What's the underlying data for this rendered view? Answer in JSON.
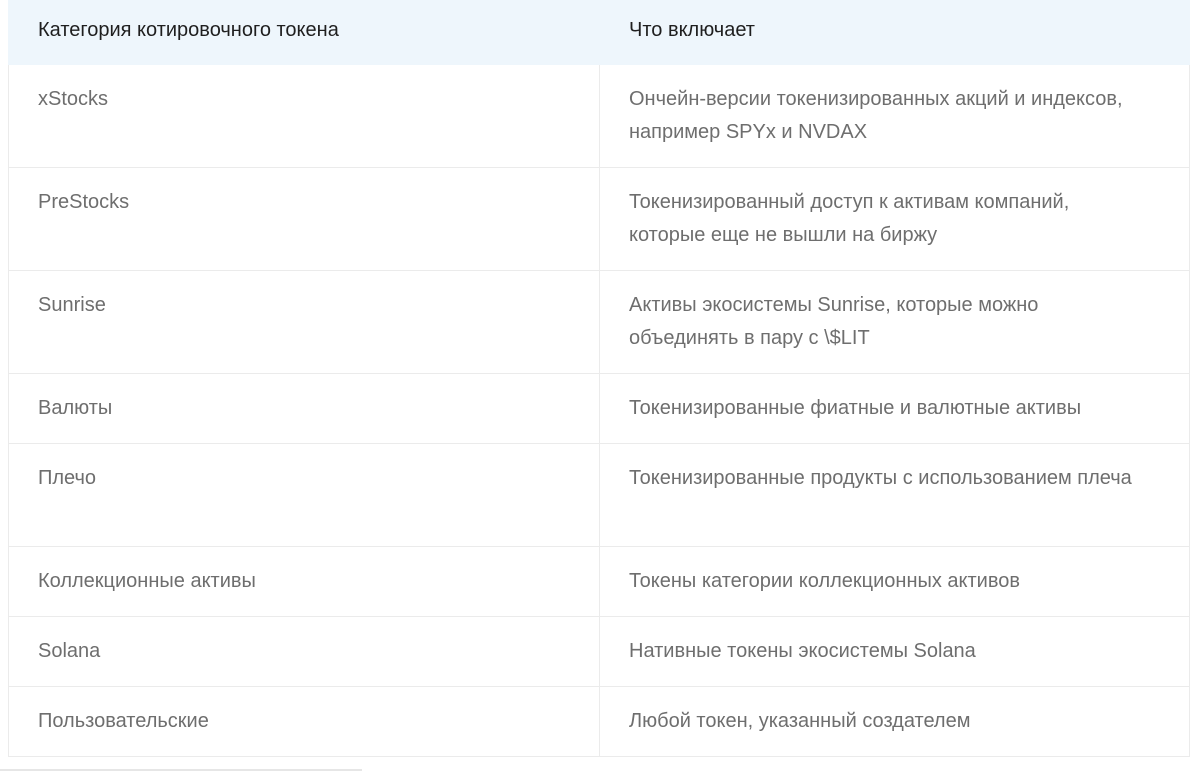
{
  "table": {
    "headers": [
      "Категория котировочного токена",
      "Что включает"
    ],
    "rows": [
      [
        "xStocks",
        "Ончейн-версии токенизированных акций и индексов, например SPYx и NVDAX"
      ],
      [
        "PreStocks",
        "Токенизированный доступ к активам компаний, которые еще не вышли на биржу"
      ],
      [
        "Sunrise",
        "Активы экосистемы Sunrise, которые можно объединять в пару с \\$LIT"
      ],
      [
        "Валюты",
        "Токенизированные фиатные и валютные активы"
      ],
      [
        "Плечо",
        "Токенизированные продукты с использованием плеча"
      ],
      [
        "Коллекционные активы",
        "Токены категории коллекционных активов"
      ],
      [
        "Solana",
        "Нативные токены экосистемы Solana"
      ],
      [
        "Пользовательские",
        "Любой токен, указанный создателем"
      ]
    ]
  }
}
